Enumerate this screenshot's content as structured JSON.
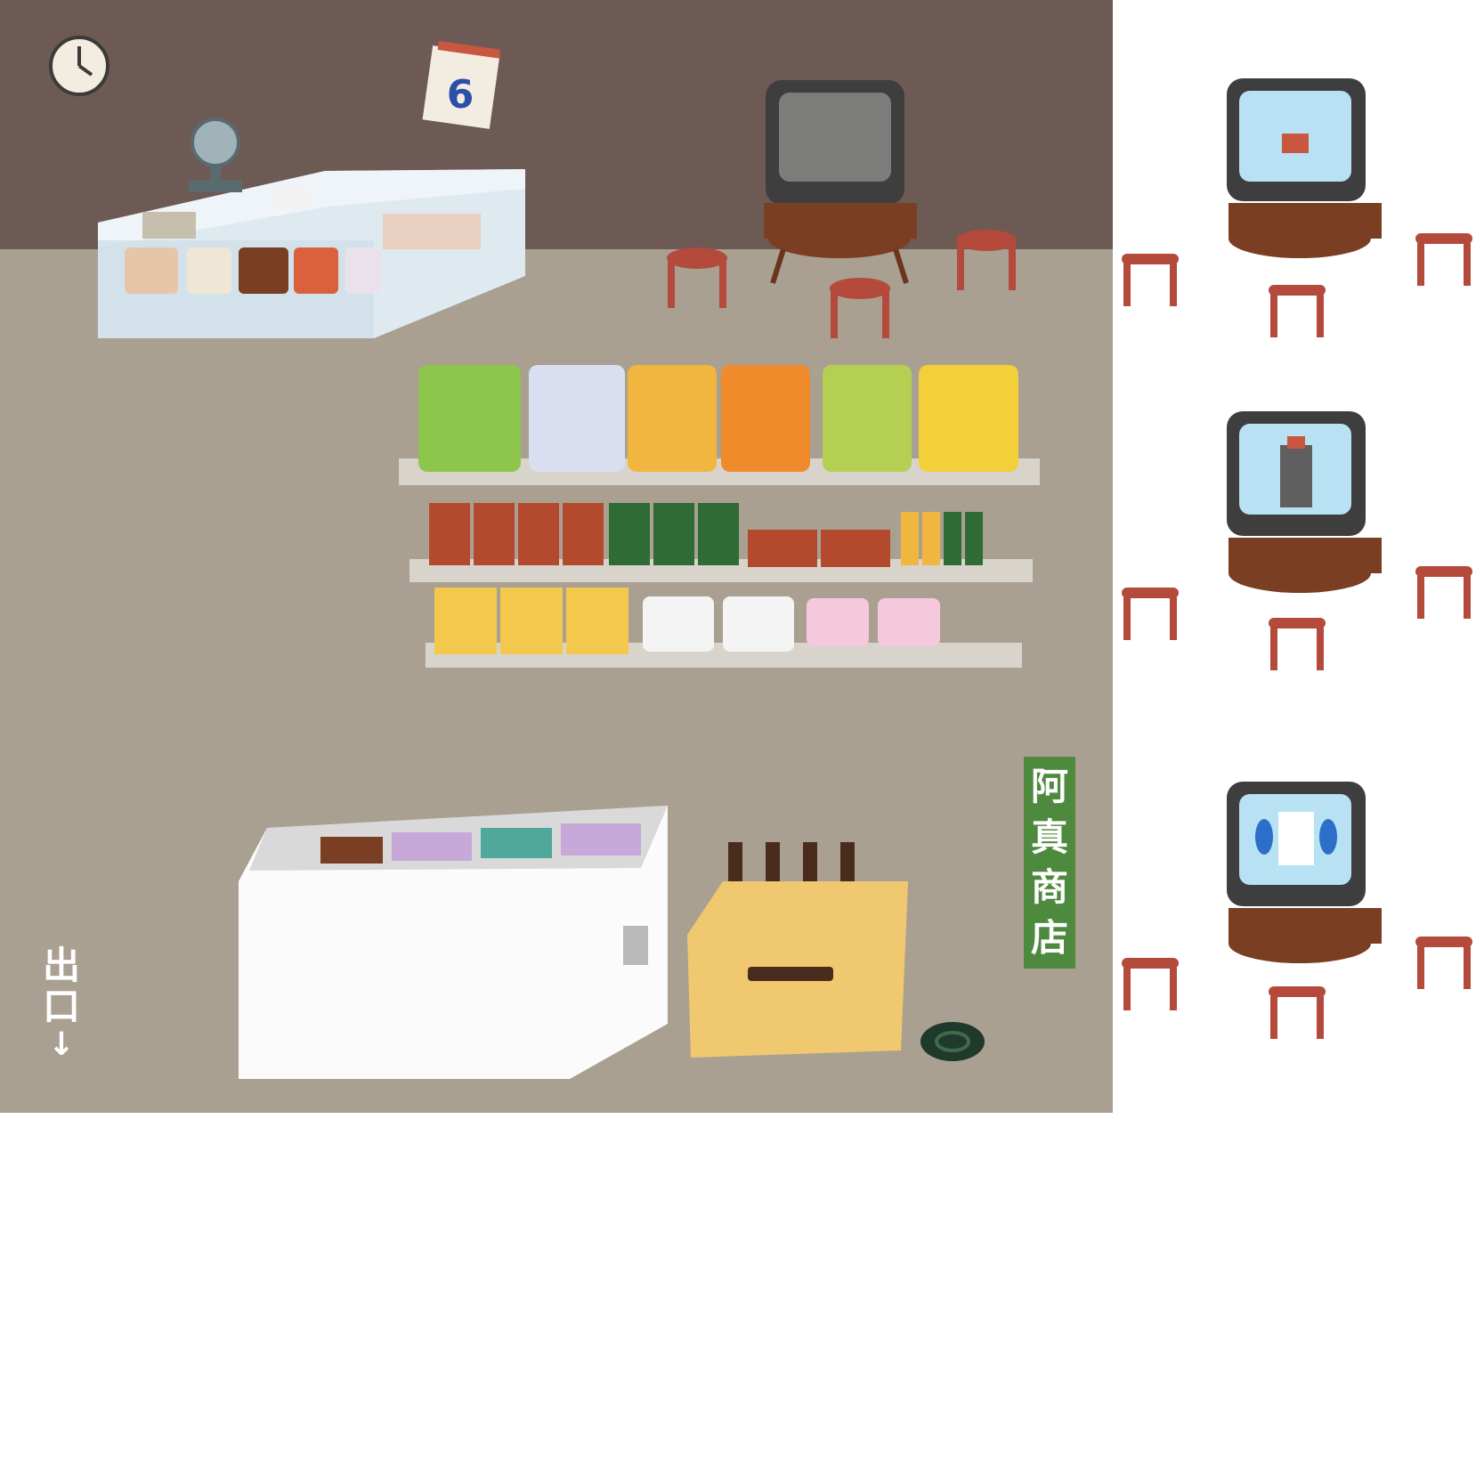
{
  "scene": {
    "store_sign": "阿真商店",
    "exit_sign": "出口",
    "exit_arrow": "↓",
    "calendar_day": "6"
  },
  "colors": {
    "wall": "#6e5a55",
    "floor": "#aaa091",
    "sign_green": "#4e8a3e",
    "stool": "#b34a3c",
    "tv_table": "#7a3e22"
  },
  "sprites": {
    "tv_variants": [
      "tv-blank",
      "tv-show-robot-small",
      "tv-show-robot-large",
      "tv-show-robot-flying"
    ]
  }
}
